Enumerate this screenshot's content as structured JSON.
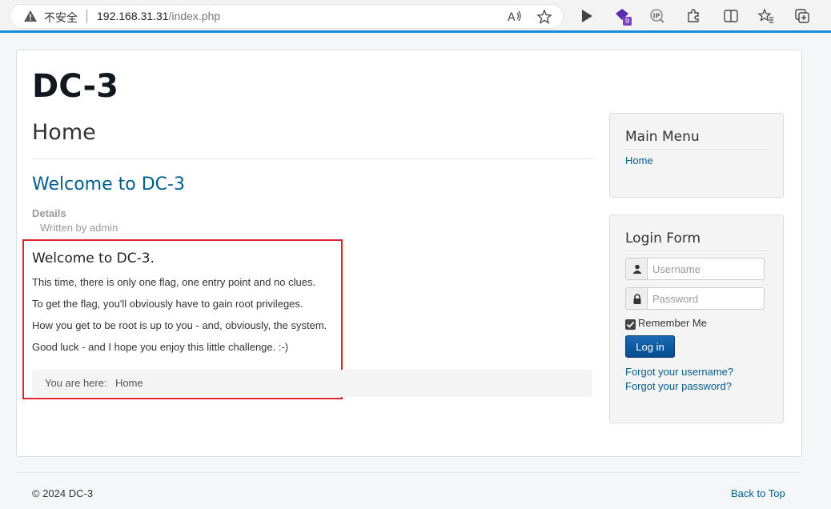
{
  "browser": {
    "security_label": "不安全",
    "url_host": "192.168.31.31",
    "url_path": "/index.php",
    "extension_badge": "9",
    "icons": [
      "warning-icon",
      "read-aloud-icon",
      "favorite-star-icon",
      "play-icon",
      "extension-gem-icon",
      "ip-extension-icon",
      "extensions-puzzle-icon",
      "split-screen-icon",
      "favorites-icon",
      "collections-icon"
    ],
    "accent_color": "#1a8ad8"
  },
  "site": {
    "brand": "DC-3"
  },
  "main": {
    "page_heading": "Home",
    "article": {
      "title": "Welcome to DC-3",
      "details_label": "Details",
      "author": "Written by admin",
      "heading": "Welcome to DC-3.",
      "paragraphs": [
        "This time, there is only one flag, one entry point and no clues.",
        "To get the flag, you'll obviously have to gain root privileges.",
        "How you get to be root is up to you - and, obviously, the system.",
        "Good luck - and I hope you enjoy this little challenge.  :-)"
      ]
    },
    "breadcrumbs": {
      "label": "You are here:",
      "current": "Home"
    }
  },
  "sidebar": {
    "main_menu": {
      "title": "Main Menu",
      "items": [
        "Home"
      ]
    },
    "login_form": {
      "title": "Login Form",
      "username_placeholder": "Username",
      "password_placeholder": "Password",
      "remember_label": "Remember Me",
      "remember_checked": true,
      "login_button": "Log in",
      "forgot_username": "Forgot your username?",
      "forgot_password": "Forgot your password?"
    }
  },
  "footer": {
    "copyright": "© 2024 DC-3",
    "back_to_top": "Back to Top"
  },
  "colors": {
    "link": "#005e8d",
    "highlight_border": "#e0242c",
    "button": "#054c8f"
  }
}
